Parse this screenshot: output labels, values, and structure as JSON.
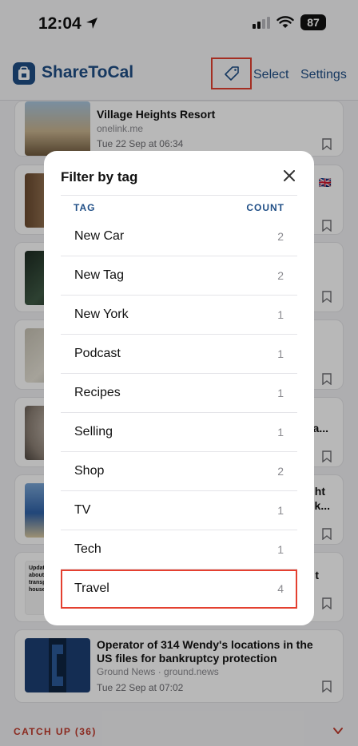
{
  "status_bar": {
    "time": "12:04",
    "battery": "87"
  },
  "header": {
    "app_title": "ShareToCal",
    "select_label": "Select",
    "settings_label": "Settings"
  },
  "cards": [
    {
      "title": "Village Heights Resort",
      "source": "onelink.me",
      "date": "Tue 22 Sep at 06:34"
    },
    {
      "title": "Operator of 314 Wendy's locations in the US files for bankruptcy protection",
      "source": "Ground News · ground.news",
      "date": "Tue 22 Sep at 07:02"
    }
  ],
  "background_fragments": {
    "flag": "🇬🇧",
    "frag1": "a...",
    "frag2a": "ht",
    "frag2b": "k...",
    "frag3": "t",
    "thumb_text": [
      "Update",
      "about th",
      "transpla",
      "house"
    ]
  },
  "catch_up": {
    "label": "CATCH UP (36)"
  },
  "modal": {
    "title": "Filter by tag",
    "col_tag": "TAG",
    "col_count": "COUNT",
    "tags": [
      {
        "name": "New Car",
        "count": "2"
      },
      {
        "name": "New Tag",
        "count": "2"
      },
      {
        "name": "New York",
        "count": "1"
      },
      {
        "name": "Podcast",
        "count": "1"
      },
      {
        "name": "Recipes",
        "count": "1"
      },
      {
        "name": "Selling",
        "count": "1"
      },
      {
        "name": "Shop",
        "count": "2"
      },
      {
        "name": "TV",
        "count": "1"
      },
      {
        "name": "Tech",
        "count": "1"
      },
      {
        "name": "Travel",
        "count": "4"
      }
    ],
    "highlighted_tag": "Travel"
  },
  "colors": {
    "accent": "#1f4e86",
    "highlight": "#e44030",
    "catch_up": "#c0392b"
  }
}
